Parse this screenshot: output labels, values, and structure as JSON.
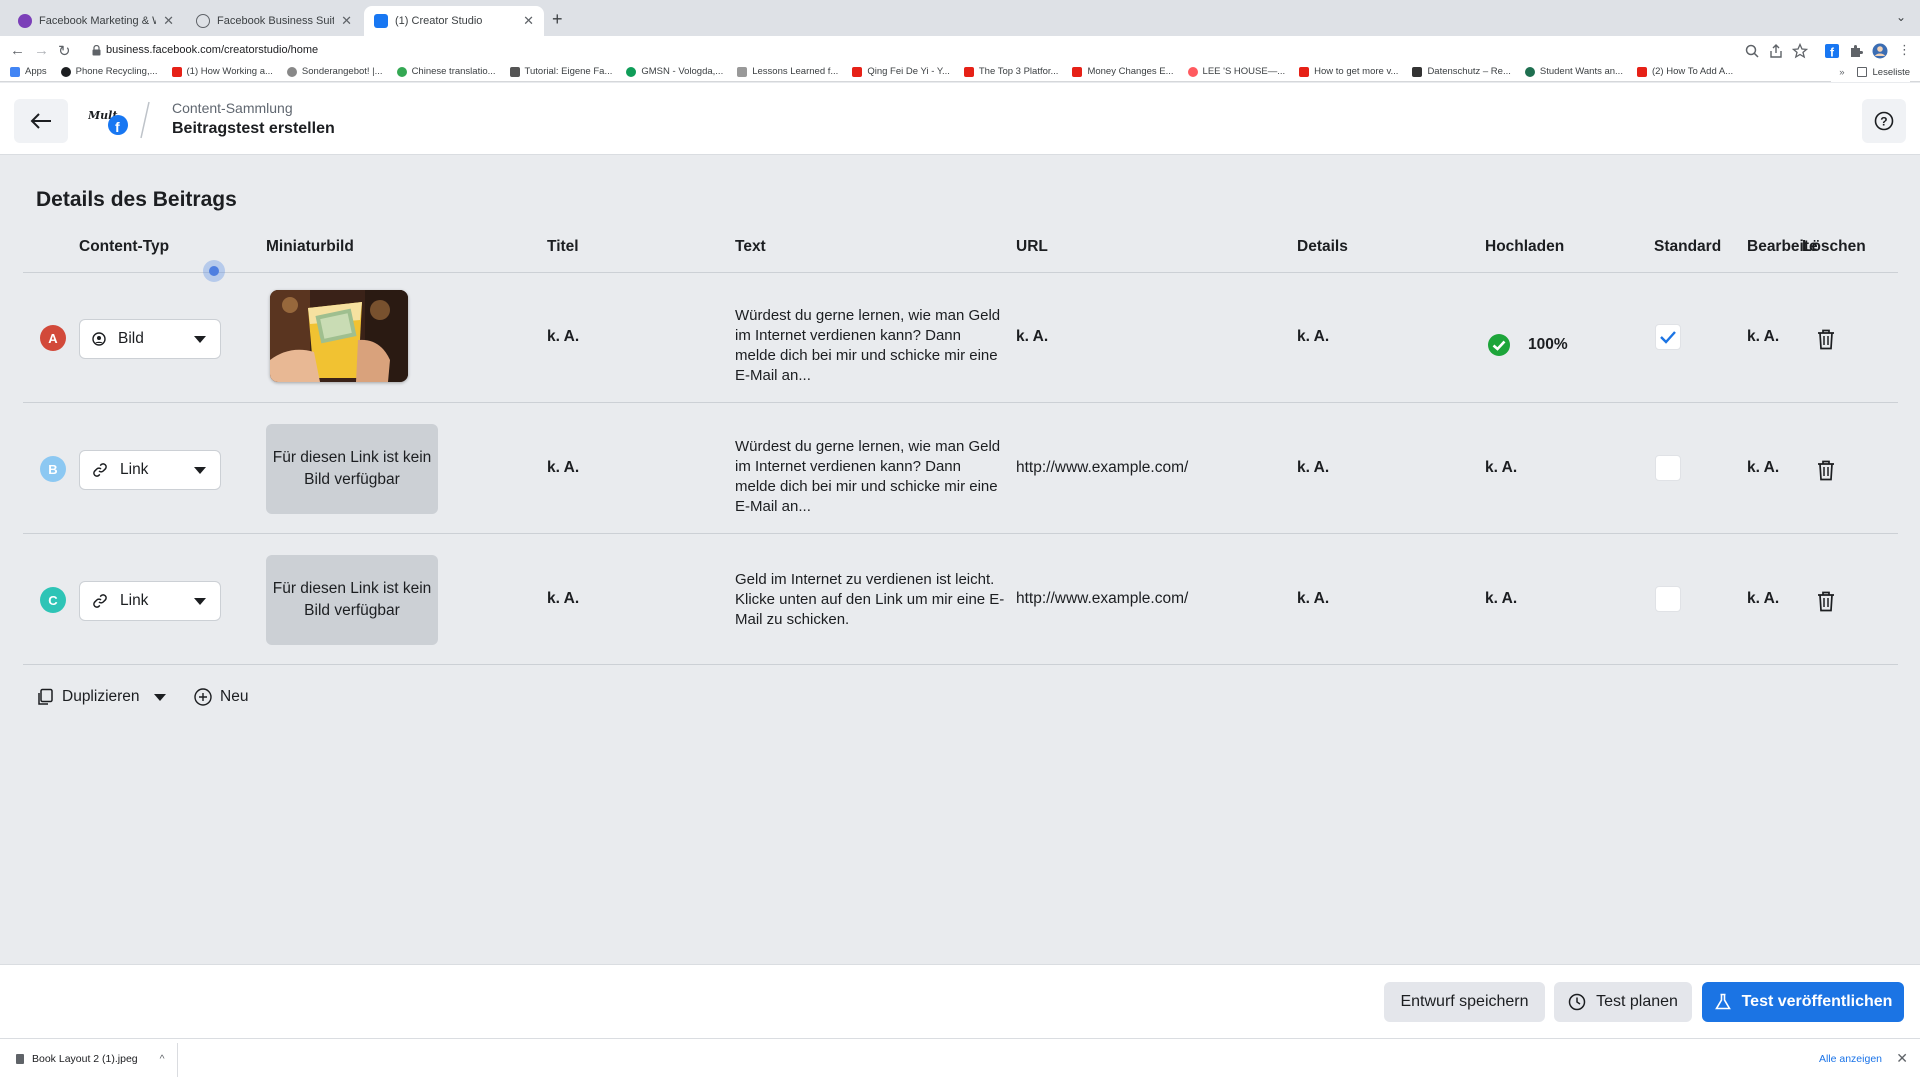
{
  "browser": {
    "tabs": [
      {
        "label": "Facebook Marketing & Werbea",
        "active": false,
        "icon": "facebook-icon"
      },
      {
        "label": "Facebook Business Suite",
        "active": false,
        "icon": "business-suite-icon"
      },
      {
        "label": "(1) Creator Studio",
        "active": true,
        "icon": "creator-studio-icon"
      }
    ],
    "url": "business.facebook.com/creatorstudio/home",
    "bookmarks": [
      "Apps",
      "Phone Recycling,...",
      "(1) How Working a...",
      "Sonderangebot! |...",
      "Chinese translatio...",
      "Tutorial: Eigene Fa...",
      "GMSN - Vologda,...",
      "Lessons Learned f...",
      "Qing Fei De Yi - Y...",
      "The Top 3 Platfor...",
      "Money Changes E...",
      "LEE 'S HOUSE—...",
      "How to get more v...",
      "Datenschutz – Re...",
      "Student Wants an...",
      "(2) How To Add A..."
    ],
    "reading_list": "Leseliste"
  },
  "header": {
    "breadcrumb": "Content-Sammlung",
    "title": "Beitragstest erstellen"
  },
  "section_title": "Details des Beitrags",
  "columns": {
    "content_type": "Content-Typ",
    "thumbnail": "Miniaturbild",
    "title": "Titel",
    "text": "Text",
    "url": "URL",
    "details": "Details",
    "upload": "Hochladen",
    "default": "Standard",
    "edit": "Bearbeiten",
    "delete": "Löschen"
  },
  "rows": [
    {
      "letter": "A",
      "badge_color": "#d2493a",
      "content_type": "Bild",
      "thumbnail_text": "",
      "title": "k. A.",
      "text": "Würdest du gerne lernen, wie man Geld im Internet verdienen kann? Dann melde dich bei mir und schicke mir eine E-Mail an...",
      "url": "k. A.",
      "details": "k. A.",
      "upload": "100%",
      "upload_status_icon": "checkmark-circle-icon",
      "default_checked": true,
      "edit": "k. A."
    },
    {
      "letter": "B",
      "badge_color": "#8cc8f2",
      "content_type": "Link",
      "thumbnail_text": "Für diesen Link ist kein Bild verfügbar",
      "title": "k. A.",
      "text": "Würdest du gerne lernen, wie man Geld im Internet verdienen kann? Dann melde dich bei mir und schicke mir eine E-Mail an...",
      "url": "http://www.example.com/",
      "details": "k. A.",
      "upload": "k. A.",
      "default_checked": false,
      "edit": "k. A."
    },
    {
      "letter": "C",
      "badge_color": "#2ec4b6",
      "content_type": "Link",
      "thumbnail_text": "Für diesen Link ist kein Bild verfügbar",
      "title": "k. A.",
      "text": "Geld im Internet zu verdienen ist leicht. Klicke unten auf den Link um mir eine E-Mail zu schicken.",
      "url": "http://www.example.com/",
      "details": "k. A.",
      "upload": "k. A.",
      "default_checked": false,
      "edit": "k. A."
    }
  ],
  "actions": {
    "duplicate": "Duplizieren",
    "new": "Neu"
  },
  "footer": {
    "save_draft": "Entwurf speichern",
    "schedule_test": "Test planen",
    "publish_test": "Test veröffentlichen"
  },
  "downloads": {
    "file": "Book Layout 2 (1).jpeg",
    "show_all": "Alle anzeigen"
  },
  "colors": {
    "primary": "#1b74e4",
    "check": "#1b74e4",
    "success": "#42b72a"
  }
}
